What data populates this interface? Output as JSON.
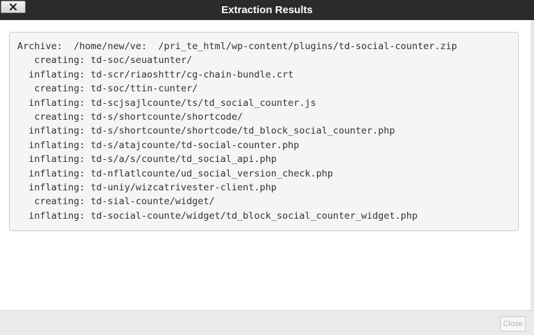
{
  "dialog": {
    "title": "Extraction Results",
    "close_icon": "close-x-icon",
    "close_button_label": "Close",
    "close_button_disabled": true
  },
  "log": {
    "lines": [
      "Archive:  /home/new/ve:  /pri_te_html/wp-content/plugins/td-social-counter.zip",
      "   creating: td-soc/seuatunter/",
      "  inflating: td-scr/riaoshttr/cg-chain-bundle.crt",
      "   creating: td-soc/ttin-cunter/",
      "  inflating: td-scjsajlcounte/ts/td_social_counter.js",
      "   creating: td-s/shortcounte/shortcode/",
      "  inflating: td-s/shortcounte/shortcode/td_block_social_counter.php",
      "  inflating: td-s/atajcounte/td-social-counter.php",
      "  inflating: td-s/a/s/counte/td_social_api.php",
      "  inflating: td-nflatlcounte/ud_social_version_check.php",
      "  inflating: td-uniy/wizcatrivester-client.php",
      "   creating: td-sial-counte/widget/",
      "  inflating: td-social-counte/widget/td_block_social_counter_widget.php"
    ]
  },
  "colors": {
    "titlebar_bg": "#2b2b2b",
    "title_text": "#ffffff",
    "log_bg": "#f5f5f5",
    "log_border": "#cccccc",
    "footer_bg": "#eaeaea",
    "disabled_text": "#b0b0b0"
  }
}
